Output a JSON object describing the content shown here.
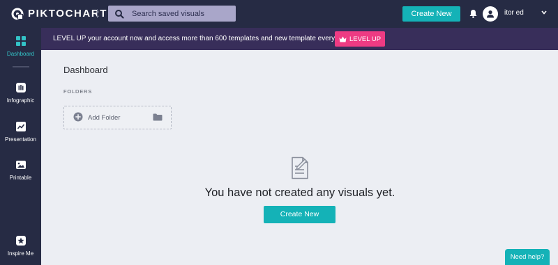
{
  "brand": {
    "name": "PIKTOCHART"
  },
  "search": {
    "placeholder": "Search saved visuals"
  },
  "header": {
    "create_label": "Create New",
    "user_name": "itor ed"
  },
  "sidebar": {
    "items": [
      {
        "label": "Dashboard",
        "icon": "dashboard-icon",
        "active": true
      },
      {
        "label": "Infographic",
        "icon": "infographic-icon"
      },
      {
        "label": "Presentation",
        "icon": "presentation-icon"
      },
      {
        "label": "Printable",
        "icon": "printable-icon"
      },
      {
        "label": "Inspire Me",
        "icon": "star-icon"
      }
    ]
  },
  "banner": {
    "text": "LEVEL UP your account now and access more than 600 templates and new template every week.",
    "button_label": "LEVEL UP"
  },
  "main": {
    "title": "Dashboard",
    "folders_label": "FOLDERS",
    "add_folder_label": "Add Folder",
    "empty_message": "You have not created any visuals yet.",
    "create_label": "Create New"
  },
  "help": {
    "label": "Need help?"
  },
  "colors": {
    "nav_bg": "#262b44",
    "banner_bg": "#382e5a",
    "accent": "#14b2b7",
    "levelup": "#ee3b83",
    "page_bg": "#eceef3"
  }
}
